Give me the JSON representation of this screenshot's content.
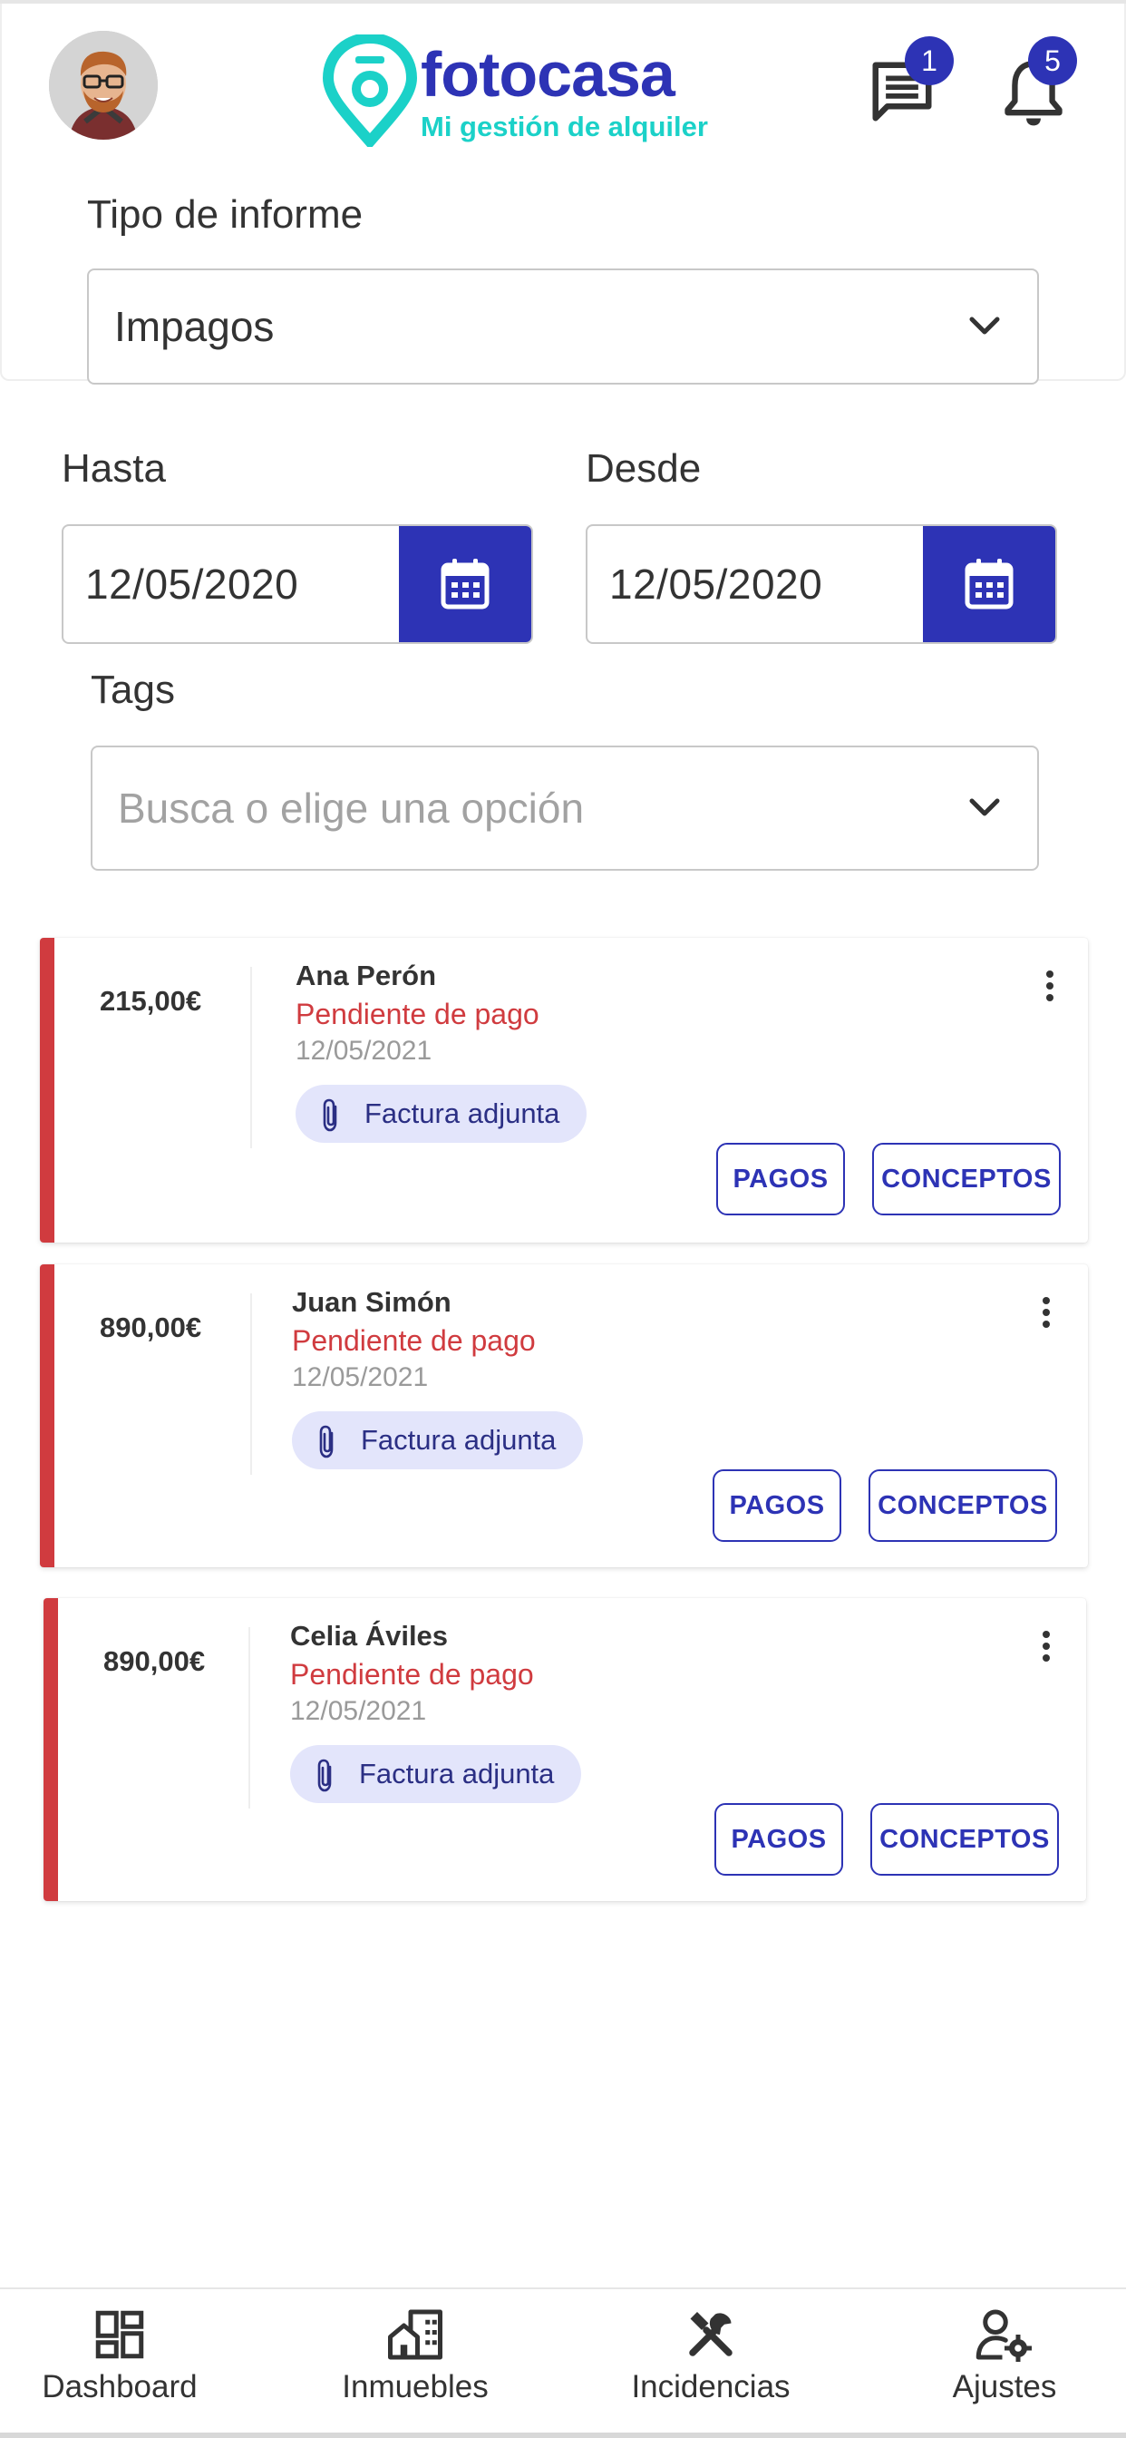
{
  "header": {
    "brand": "fotocasa",
    "subtitle": "Mi gestión de alquiler",
    "messages_badge": "1",
    "notifications_badge": "5"
  },
  "filters": {
    "report_type_label": "Tipo de informe",
    "report_type_value": "Impagos",
    "until_label": "Hasta",
    "until_value": "12/05/2020",
    "from_label": "Desde",
    "from_value": "12/05/2020",
    "tags_label": "Tags",
    "tags_placeholder": "Busca o elige una opción"
  },
  "cards": [
    {
      "amount": "215,00€",
      "name": "Ana Perón",
      "status": "Pendiente de pago",
      "date": "12/05/2021",
      "attachment": "Factura adjunta",
      "payments_label": "PAGOS",
      "concepts_label": "CONCEPTOS"
    },
    {
      "amount": "890,00€",
      "name": "Juan Simón",
      "status": "Pendiente de pago",
      "date": "12/05/2021",
      "attachment": "Factura adjunta",
      "payments_label": "PAGOS",
      "concepts_label": "CONCEPTOS"
    },
    {
      "amount": "890,00€",
      "name": "Celia Áviles",
      "status": "Pendiente de pago",
      "date": "12/05/2021",
      "attachment": "Factura adjunta",
      "payments_label": "PAGOS",
      "concepts_label": "CONCEPTOS"
    }
  ],
  "nav": [
    {
      "label": "Dashboard",
      "icon": "dashboard-icon"
    },
    {
      "label": "Inmuebles",
      "icon": "buildings-icon"
    },
    {
      "label": "Incidencias",
      "icon": "tools-icon"
    },
    {
      "label": "Ajustes",
      "icon": "user-settings-icon"
    }
  ],
  "colors": {
    "brand": "#2d33b5",
    "accent": "#1bd1c8",
    "alert": "#d03b3f",
    "chip": "#e3e5fb"
  }
}
